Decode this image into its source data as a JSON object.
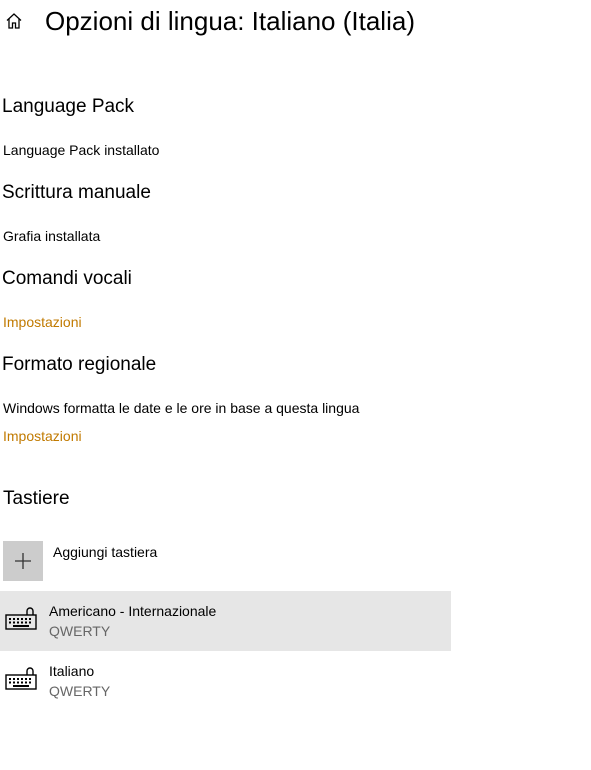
{
  "header": {
    "title": "Opzioni di lingua: Italiano (Italia)",
    "home_icon": "home-icon"
  },
  "language_pack": {
    "heading": "Language Pack",
    "status": "Language Pack installato"
  },
  "handwriting": {
    "heading": "Scrittura manuale",
    "status": "Grafia installata"
  },
  "voice_commands": {
    "heading": "Comandi vocali",
    "settings_link": "Impostazioni"
  },
  "regional_format": {
    "heading": "Formato regionale",
    "description": "Windows formatta le date e le ore in base a questa lingua",
    "settings_link": "Impostazioni"
  },
  "keyboards": {
    "heading": "Tastiere",
    "add_label": "Aggiungi tastiera",
    "add_icon": "plus-icon",
    "items": [
      {
        "name": "Americano - Internazionale",
        "layout": "QWERTY",
        "icon": "keyboard-icon",
        "selected": true
      },
      {
        "name": "Italiano",
        "layout": "QWERTY",
        "icon": "keyboard-icon",
        "selected": false
      }
    ]
  },
  "colors": {
    "link": "#c17a00",
    "selected_row": "#e6e6e6",
    "add_tile": "#cccccc",
    "secondary_text": "#666666"
  }
}
